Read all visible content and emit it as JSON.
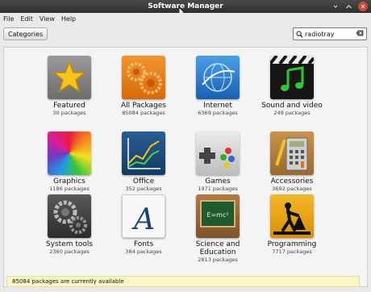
{
  "window": {
    "title": "Software Manager"
  },
  "menu": {
    "items": [
      "File",
      "Edit",
      "View",
      "Help"
    ]
  },
  "toolbar": {
    "categories_label": "Categories"
  },
  "search": {
    "value": "radiotray"
  },
  "tiles": [
    {
      "label": "Featured",
      "count": "30 packages",
      "icon": "star-icon",
      "color": "#8a8a8a"
    },
    {
      "label": "All Packages",
      "count": "85084 packages",
      "icon": "gears-icon",
      "color": "#e87a14"
    },
    {
      "label": "Internet",
      "count": "6369 packages",
      "icon": "globe-icon",
      "color": "#2a7fcf"
    },
    {
      "label": "Sound and video",
      "count": "249 packages",
      "icon": "music-note-icon",
      "color": "#1a1a1a"
    },
    {
      "label": "Graphics",
      "count": "1186 packages",
      "icon": "color-wheel-icon",
      "color": "#d4215f"
    },
    {
      "label": "Office",
      "count": "352 packages",
      "icon": "chart-icon",
      "color": "#1c4a7a"
    },
    {
      "label": "Games",
      "count": "1971 packages",
      "icon": "gamepad-icon",
      "color": "#d6d6d6"
    },
    {
      "label": "Accessories",
      "count": "3692 packages",
      "icon": "calculator-icon",
      "color": "#b8813a"
    },
    {
      "label": "System tools",
      "count": "2360 packages",
      "icon": "gear-icon",
      "color": "#4a4a4a"
    },
    {
      "label": "Fonts",
      "count": "384 packages",
      "icon": "font-icon",
      "color": "#f7f7f7"
    },
    {
      "label": "Science and Education",
      "count": "2813 packages",
      "icon": "chalkboard-icon",
      "color": "#a06b3a"
    },
    {
      "label": "Programming",
      "count": "7717 packages",
      "icon": "construction-icon",
      "color": "#e3a617"
    }
  ],
  "status": "85084 packages are currently available"
}
